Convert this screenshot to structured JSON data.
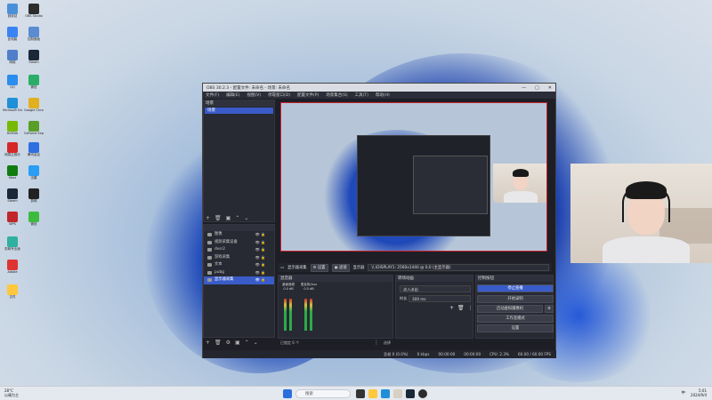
{
  "desktop": {
    "icons": [
      {
        "label": "回收站",
        "color": "#4a90d9"
      },
      {
        "label": "OBS Studio",
        "color": "#2c2c2c"
      },
      {
        "label": "此电脑",
        "color": "#3b82f6"
      },
      {
        "label": "控制面板",
        "color": "#5b8bd0"
      },
      {
        "label": "网络",
        "color": "#4f7fc9"
      },
      {
        "label": "Steam",
        "color": "#1b2838"
      },
      {
        "label": "QQ",
        "color": "#2d8cf0"
      },
      {
        "label": "微信",
        "color": "#2aae67"
      },
      {
        "label": "Microsoft Edge",
        "color": "#1f8fd8"
      },
      {
        "label": "Google Chrome",
        "color": "#e0b020"
      },
      {
        "label": "NVIDIA",
        "color": "#76b900"
      },
      {
        "label": "GeForce Experience",
        "color": "#5a9e2a"
      },
      {
        "label": "网易云音乐",
        "color": "#d52828"
      },
      {
        "label": "腾讯会议",
        "color": "#2f6fe0"
      },
      {
        "label": "Xbox",
        "color": "#107c10"
      },
      {
        "label": "迅雷",
        "color": "#2a9df4"
      },
      {
        "label": "Steam",
        "color": "#1b2838"
      },
      {
        "label": "剪映",
        "color": "#222"
      },
      {
        "label": "WPS",
        "color": "#c0262b"
      },
      {
        "label": "微信",
        "color": "#3dbb3d"
      },
      {
        "label": "剪映专业版",
        "color": "#30b0a0"
      },
      {
        "label": "Adobe",
        "color": "#d33"
      },
      {
        "label": "文件",
        "color": "#ffc83d"
      }
    ]
  },
  "obs": {
    "title": "OBS 30.2.3 - 配置文件: 未命名 - 场景: 未命名",
    "menu": [
      "文件(F)",
      "编辑(E)",
      "视图(V)",
      "停靠窗口(D)",
      "配置文件(P)",
      "场景集合(S)",
      "工具(T)",
      "帮助(H)"
    ],
    "scenes_header": "场景",
    "scenes": [
      "场景"
    ],
    "sources": [
      {
        "label": "图像",
        "selected": false
      },
      {
        "label": "视频采集设备",
        "selected": false
      },
      {
        "label": "dvsr2",
        "selected": false
      },
      {
        "label": "游戏采集",
        "selected": false
      },
      {
        "label": "文本",
        "selected": false
      },
      {
        "label": "pubg",
        "selected": false
      },
      {
        "label": "显示器采集",
        "selected": true
      }
    ],
    "preview_toolbar": {
      "source_name": "显示器采集",
      "settings_label": "设置",
      "filters_label": "滤镜",
      "display_label": "显示器",
      "display_value": "\\\\.\\DISPLAY1: 2560x1440 @ 0,0 (主显示器)"
    },
    "audio_header": "混音器",
    "audio_channels": [
      {
        "label": "桌面音频",
        "db": "0.0 dB"
      },
      {
        "label": "麦克风/Aux",
        "db": "0.0 dB"
      }
    ],
    "transitions": {
      "header": "转场动画",
      "type": "淡入淡出",
      "duration_label": "时长",
      "duration_value": "300 ms"
    },
    "controls": {
      "header": "控制按钮",
      "buttons": [
        "停止直播",
        "开始录制",
        "启动虚拟摄像机",
        "工作室模式",
        "设置"
      ]
    },
    "status": {
      "dropped": "丢帧 0 (0.0%)",
      "bitrate": "0 kbps",
      "live_time": "00:00:00",
      "rec_time": "00:00:00",
      "cpu": "CPU: 2.3%",
      "fps": "60.00 / 60.00 FPS"
    },
    "scene_toolbar_label": "已锁定 6 个",
    "mix_label": "选择"
  },
  "taskbar": {
    "weather_temp": "28°C",
    "weather_desc": "以晴为主",
    "search_placeholder": "搜索",
    "time": "5:01",
    "date": "2024/9/4",
    "lang": "中"
  },
  "colors": {
    "accent": "#3a5cc8",
    "preview_border": "#c8202a"
  }
}
